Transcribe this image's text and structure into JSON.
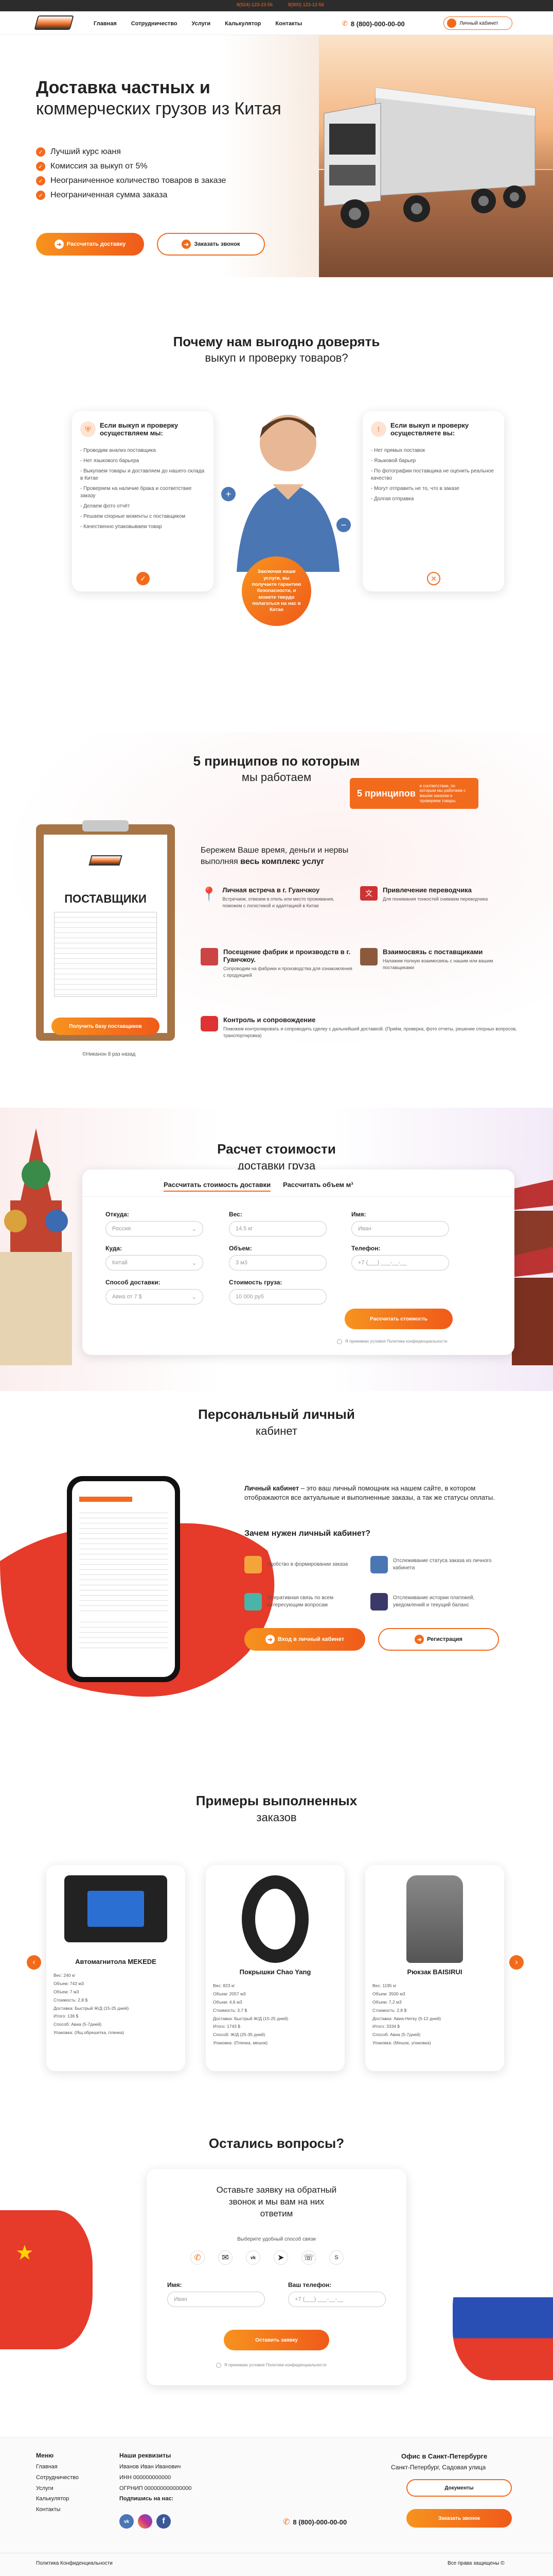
{
  "topbar": {
    "phone1": "8(924)-123-23-56",
    "phone2": "8(900) 123-12-56"
  },
  "header": {
    "nav": [
      "Главная",
      "Сотрудничество",
      "Услуги",
      "Калькулятор",
      "Контакты"
    ],
    "phone": "8 (800)-000-00-00",
    "cabinet": "Личный кабинет"
  },
  "hero": {
    "title1": "Доставка частных и",
    "title2": "коммерческих грузов из Китая",
    "features": [
      "Лучший курс юаня",
      "Комиссия за выкуп от 5%",
      "Неограниченное количество товаров в заказе",
      "Неограниченная сумма заказа"
    ],
    "btn1": "Рассчитать доставку",
    "btn2": "Заказать звонок"
  },
  "why": {
    "title1": "Почему нам выгодно доверять",
    "title2": "выкуп и проверку товаров?",
    "left": {
      "heading": "Если выкуп и проверку осуществляем мы:",
      "items": [
        "- Проводим анализ поставщика",
        "- Нет языкового барьера",
        "- Выкупаем товары и доставляем до нашего склада в Китае",
        "- Проверяем на наличие брака и соответствие заказу",
        "- Делаем фото отчёт",
        "- Решаем спорные моменты с поставщиком",
        "- Качественно упаковываем товар"
      ]
    },
    "right": {
      "heading": "Если выкуп и проверку осуществляете вы:",
      "items": [
        "- Нет прямых поставок",
        "- Языковой барьер",
        "- По фотографии поставщика не оценить реальное качество",
        "- Могут отправить не то, что в заказе",
        "- Долгая отправка"
      ]
    },
    "bubble": "Заключая наши услуги, вы получаете гарантию безопасности, и можете твердо полагаться на нас в Китае"
  },
  "principles": {
    "title1": "5 принципов по которым",
    "title2": "мы работаем",
    "badge": "5 принципов",
    "badge_sub": "в соответствии, по которым мы работаем с вашим заказом и проверяем товары",
    "clip_title": "ПОСТАВЩИКИ",
    "clip_btn": "Получить базу поставщиков",
    "clip_note": "©Никанон 8 раз назад",
    "intro1": "Бережем Ваше время, деньги и нервы",
    "intro2": "выполняя ",
    "intro3": "весь комплекс услуг",
    "items": [
      {
        "title": "Личная встреча в г. Гуанчжоу",
        "text": "Встречаем, отвезем в отель или место проживания, поможем с логистикой и адаптацией в Китае"
      },
      {
        "title": "Привлечение переводчика",
        "text": "Для понимания тонкостей снимаем переводчика"
      },
      {
        "title": "Посещение фабрик и производств в г. Гуанчжоу.",
        "text": "Сопроводим на фабрики и производства для ознакомления с продукцией"
      },
      {
        "title": "Взаимосвязь с поставщиками",
        "text": "Налажим полную взаимосвязь с нашим или вашим поставщиками"
      },
      {
        "title": "Контроль и сопровождение",
        "text": "Поможем контролировать и сопроводить сделку с дальнейшей доставкой. (Приём, проверка, фото отчеты, решение спорных вопросов, транспортировка)"
      }
    ]
  },
  "calc": {
    "title1": "Расчет стоимости",
    "title2": "доставки груза",
    "tab1": "Рассчитать стоимость доставки",
    "tab2": "Рассчитать объем м³",
    "labels": {
      "from": "Откуда:",
      "to": "Куда:",
      "method": "Способ доставки:",
      "weight": "Вес:",
      "volume": "Объем:",
      "cost": "Стоимость груза:",
      "name": "Имя:",
      "phone": "Телефон:"
    },
    "values": {
      "from": "Россия",
      "to": "Китай",
      "method": "Авиа от 7 $",
      "weight": "14.5 кг",
      "volume": "3 м3",
      "cost": "10 000 руб",
      "name": "Иван",
      "phone": "+7 (___) ___-__-__"
    },
    "btn": "Рассчитать стоимость",
    "consent": "Я принимаю условия Политики конфиденциальности"
  },
  "cabinet": {
    "title1": "Персональный личный",
    "title2": "кабинет",
    "desc_b": "Личный кабинет",
    "desc": " – это ваш личный помощник на нашем сайте, в котором отображаются все актуальные и выполненные заказы, а так же статусы оплаты.",
    "why": "Зачем нужен личный кабинет?",
    "items": [
      "Удобство в формировании заказа",
      "Отслеживание статуса заказа из личного кабинета",
      "Оперативная связь по всем интересующим вопросам",
      "Отслеживание истории платежей, уведомлений и текущий баланс"
    ],
    "btn1": "Вход в личный кабинет",
    "btn2": "Регистрация"
  },
  "examples": {
    "title1": "Примеры выполненных",
    "title2": "заказов",
    "items": [
      {
        "name": "Автомагнитола MEKEDE",
        "rows": [
          "Вес: 240 кг",
          "Объем: 743 м3",
          "Объем: 7 м3",
          "Стоимость: 2,8 $",
          "Доставка: Быстрый Ж/Д (15-25 дней)",
          "Итого: 136 $",
          "Способ: Авиа (5-7дней)",
          "Упаковка: (Ящ.обрешетка, пленка)"
        ]
      },
      {
        "name": "Покрышки Chao Yang",
        "rows": [
          "Вес: 823 кг",
          "Объем: 2057 м3",
          "Объем: 4,6 м3",
          "Стоимость: 3,7 $",
          "Доставка: Быстрый Ж/Д (15-25 дней)",
          "Итого: 1743 $",
          "Способ: Ж/Д (25-35 дней)",
          "Упаковка: (Пленка, мешок)"
        ]
      },
      {
        "name": "Рюкзак BAISIRUI",
        "rows": [
          "Вес: 1195 кг",
          "Объем: 3500 м3",
          "Объем: 7,2 м3",
          "Стоимость: 2,8 $",
          "Доставка: Авиа-Нитку (5-12 дней)",
          "Итого: 3334 $",
          "Способ: Авиа (5-7дней)",
          "Упаковка: (Мешок, упаковка)"
        ]
      }
    ]
  },
  "contact": {
    "title": "Остались вопросы?",
    "card_title1": "Оставьте заявку на обратный",
    "card_title2": "звонок и мы вам на них",
    "card_title3": "ответим",
    "pick": "Выберите удобный способ связи",
    "name_l": "Имя:",
    "phone_l": "Ваш телефон:",
    "name_v": "Иван",
    "phone_v": "+7 (___) ___-__-__",
    "btn": "Оставить заявку",
    "consent": "Я принимаю условия Политики конфиденциальности"
  },
  "footer": {
    "menu_t": "Меню",
    "menu": [
      "Главная",
      "Сотрудничество",
      "Услуги",
      "Калькулятор",
      "Контакты"
    ],
    "req_t": "Наши реквизиты",
    "req": [
      "Иванов Иван Иванович",
      "ИНН 000000000000",
      "ОГРНИП 000000000000000"
    ],
    "sub_t": "Подпишись на нас:",
    "phone": "8 (800)-000-00-00",
    "office_t": "Офис в Санкт-Петербурге",
    "office": "Санкт-Петербург, Садовая улица",
    "docs": "Документы",
    "call": "Заказать звонок",
    "policy": "Политика Конфиденциальности",
    "rights": "Все права защищены ©"
  },
  "colors": {
    "accent": "#f26b1d",
    "dark": "#222222"
  }
}
